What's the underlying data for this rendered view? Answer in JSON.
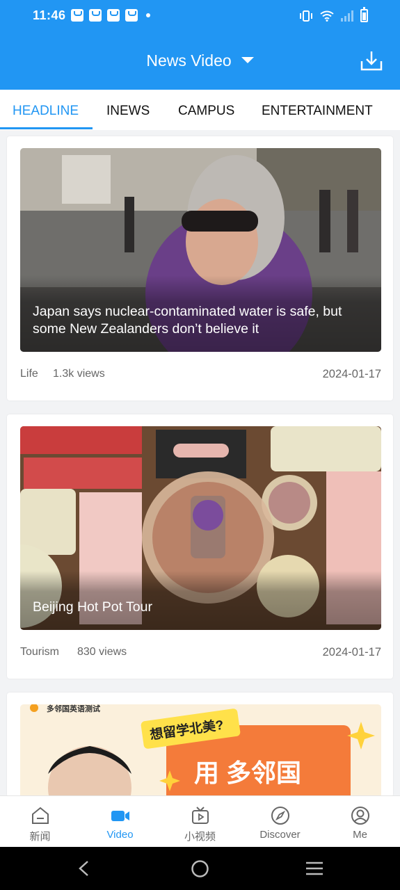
{
  "status_bar": {
    "time": "11:46"
  },
  "header": {
    "title": "News Video",
    "download_icon": "download-icon"
  },
  "tabs": [
    {
      "label": "HEADLINE",
      "active": true
    },
    {
      "label": "INEWS",
      "active": false
    },
    {
      "label": "CAMPUS",
      "active": false
    },
    {
      "label": "ENTERTAINMENT",
      "active": false
    }
  ],
  "feed": [
    {
      "title": "Japan says nuclear-contaminated water is safe, but some New Zealanders don’t believe it",
      "category": "Life",
      "views": "1.3k views",
      "date": "2024-01-17"
    },
    {
      "title": "Beijing Hot Pot Tour",
      "category": "Tourism",
      "views": "830 views",
      "date": "2024-01-17"
    },
    {
      "ad_bubble": "想留学北美?",
      "ad_headline": "用 多邻国",
      "ad_brand": "多邻国英语测试"
    }
  ],
  "bottom_nav": [
    {
      "label": "新闻",
      "icon": "home-icon",
      "active": false
    },
    {
      "label": "Video",
      "icon": "video-camera-icon",
      "active": true
    },
    {
      "label": "小视频",
      "icon": "tv-play-icon",
      "active": false
    },
    {
      "label": "Discover",
      "icon": "compass-icon",
      "active": false
    },
    {
      "label": "Me",
      "icon": "user-icon",
      "active": false
    }
  ],
  "colors": {
    "primary": "#2196f3",
    "inactive": "#666666"
  }
}
